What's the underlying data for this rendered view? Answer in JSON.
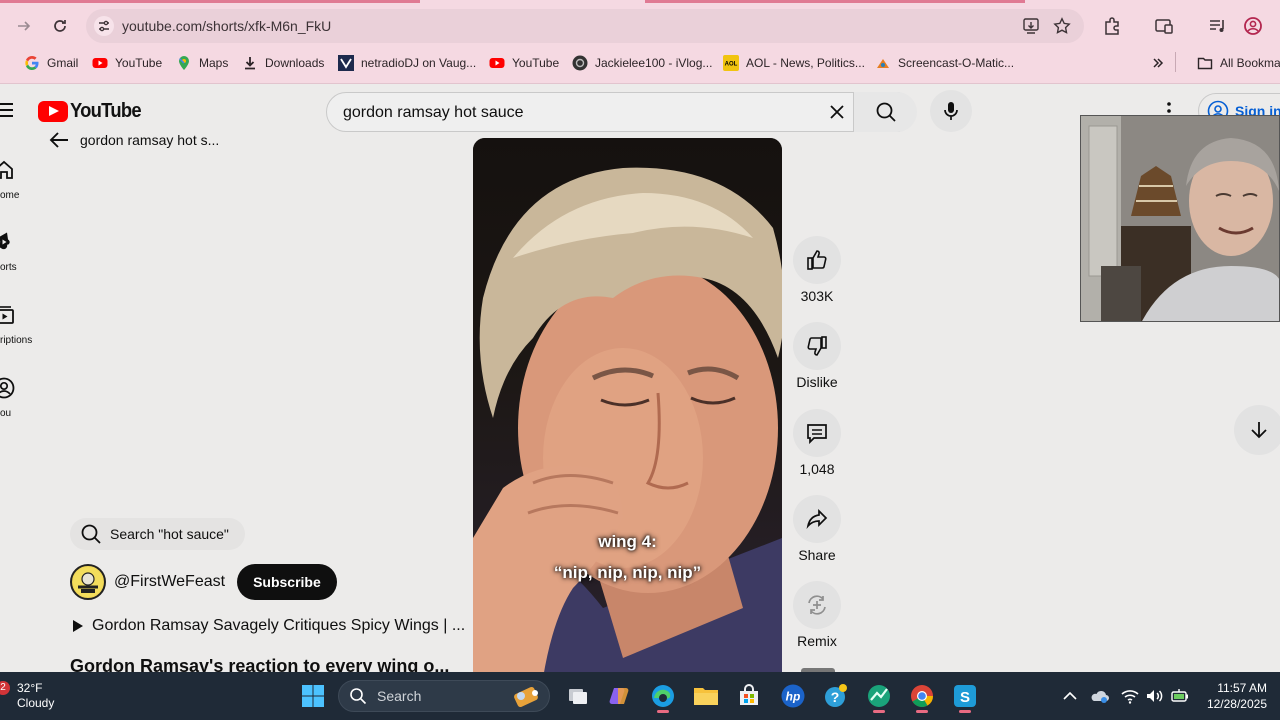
{
  "browser": {
    "url": "youtube.com/shorts/xfk-M6n_FkU",
    "bookmarks": [
      {
        "label": "Gmail",
        "icon": "google-icon"
      },
      {
        "label": "YouTube",
        "icon": "youtube-icon"
      },
      {
        "label": "Maps",
        "icon": "maps-icon"
      },
      {
        "label": "Downloads",
        "icon": "download-icon"
      },
      {
        "label": "netradioDJ on Vaug...",
        "icon": "vaughn-icon"
      },
      {
        "label": "YouTube",
        "icon": "youtube-icon"
      },
      {
        "label": "Jackielee100 - iVlog...",
        "icon": "ivlog-icon"
      },
      {
        "label": "AOL - News, Politics...",
        "icon": "aol-icon"
      },
      {
        "label": "Screencast-O-Matic...",
        "icon": "screencast-icon"
      }
    ],
    "all_bookmarks": "All Bookma"
  },
  "youtube": {
    "logo_text": "YouTube",
    "search_value": "gordon ramsay hot sauce",
    "sign_in": "Sign in",
    "back_title": "gordon ramsay hot s...",
    "nav": [
      {
        "label": "ome",
        "icon": "home-icon"
      },
      {
        "label": "orts",
        "icon": "shorts-icon"
      },
      {
        "label": "riptions",
        "icon": "subscriptions-icon"
      },
      {
        "label": "ou",
        "icon": "you-icon"
      }
    ],
    "subtitle_line1": "wing 4:",
    "subtitle_line2": "“nip, nip, nip, nip”",
    "actions": {
      "likes": "303K",
      "dislike": "Dislike",
      "comments": "1,048",
      "share": "Share",
      "remix": "Remix"
    },
    "search_chip": "Search \"hot sauce\"",
    "channel": "@FirstWeFeast",
    "subscribe": "Subscribe",
    "related_video": "Gordon Ramsay Savagely Critiques Spicy Wings | ...",
    "short_title": "Gordon Ramsay's reaction to every wing o..."
  },
  "taskbar": {
    "weather_badge": "2",
    "temperature": "32°F",
    "weather": "Cloudy",
    "search_placeholder": "Search",
    "time": "11:57 AM",
    "date": "12/28/2025"
  },
  "colors": {
    "chrome_bg": "#f5d9e2",
    "yt_red": "#ff0000",
    "taskbar": "#1f2a37",
    "link_blue": "#065fd4"
  }
}
